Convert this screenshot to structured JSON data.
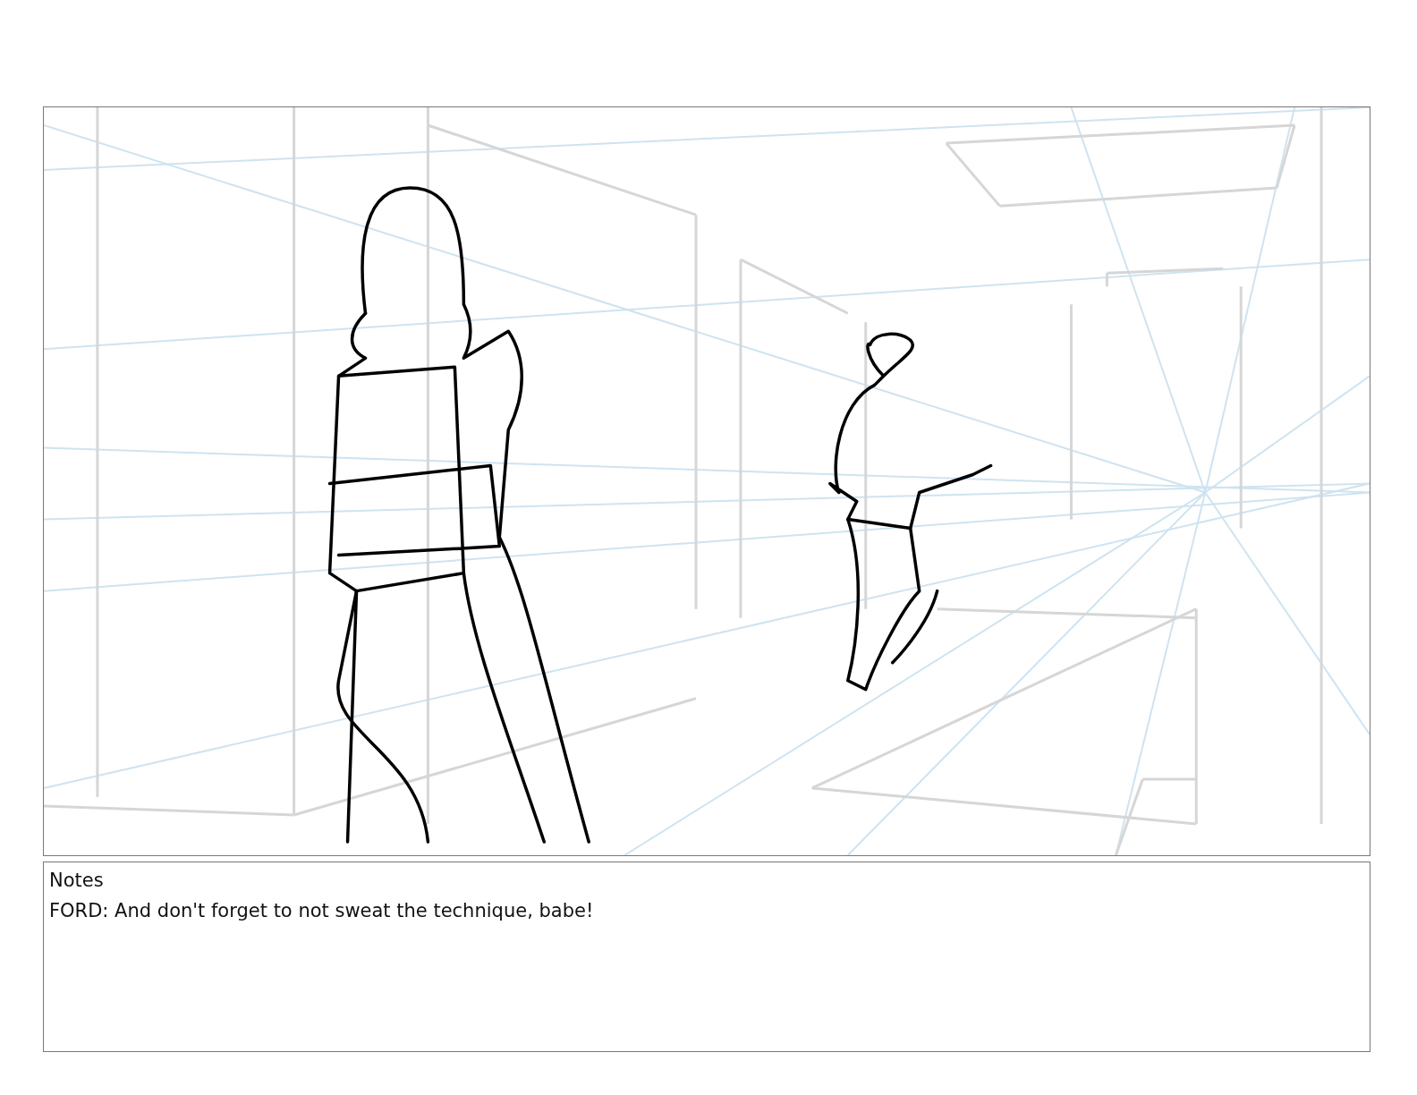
{
  "notes": {
    "label": "Notes",
    "text": "FORD: And don't forget to not sweat the technique, babe!"
  }
}
